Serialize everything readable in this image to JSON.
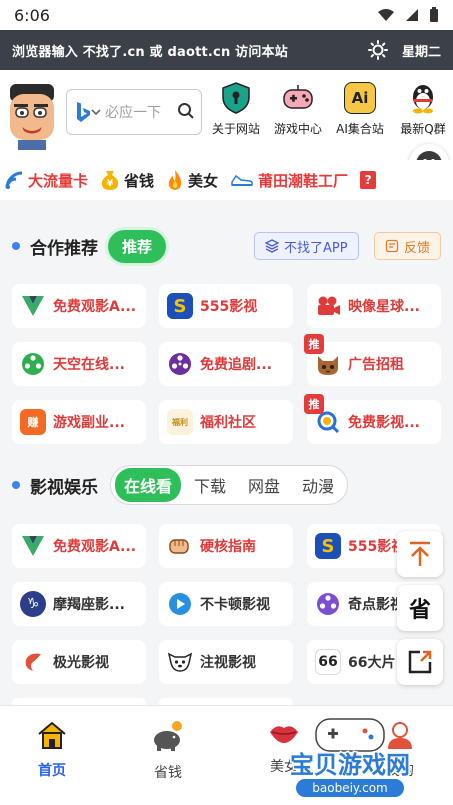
{
  "status": {
    "time": "6:06"
  },
  "banner": {
    "message": "浏览器输入 不找了.cn 或 daott.cn 访问本站",
    "weekday": "星期二"
  },
  "search": {
    "placeholder": "必应一下"
  },
  "quick_links": [
    {
      "label": "关于网站",
      "icon": "shield-keyhole-icon"
    },
    {
      "label": "游戏中心",
      "icon": "gamepad-icon"
    },
    {
      "label": "AI集合站",
      "icon": "ai-icon"
    },
    {
      "label": "最新Q群",
      "icon": "qq-penguin-icon"
    }
  ],
  "tags": [
    {
      "label": "大流量卡",
      "icon": "signal-icon"
    },
    {
      "label": "省钱",
      "icon": "money-bag-icon"
    },
    {
      "label": "美女",
      "icon": "fire-icon"
    },
    {
      "label": "莆田潮鞋工厂",
      "icon": "sneaker-icon"
    },
    {
      "label": "?",
      "icon": "question-icon"
    }
  ],
  "partner": {
    "title": "合作推荐",
    "pill": "推荐",
    "app_button": "不找了APP",
    "feedback_button": "反馈",
    "items": [
      {
        "label": "免费观影A...",
        "icon": "v-logo-icon",
        "style": "red"
      },
      {
        "label": "555影视",
        "icon": "s-logo-icon",
        "style": "red"
      },
      {
        "label": "映像星球...",
        "icon": "camera-icon",
        "style": "red"
      },
      {
        "label": "天空在线...",
        "icon": "film-reel-icon",
        "style": "red"
      },
      {
        "label": "免费追剧...",
        "icon": "film-reel-icon",
        "style": "red"
      },
      {
        "label": "广告招租",
        "icon": "cat-icon",
        "style": "red",
        "badge": "推"
      },
      {
        "label": "游戏副业...",
        "icon": "earn-icon",
        "style": "red"
      },
      {
        "label": "福利社区",
        "icon": "welfare-icon",
        "style": "red"
      },
      {
        "label": "免费影视...",
        "icon": "q-search-icon",
        "style": "red",
        "badge": "推"
      }
    ]
  },
  "video": {
    "title": "影视娱乐",
    "tabs": [
      "在线看",
      "下载",
      "网盘",
      "动漫"
    ],
    "items": [
      {
        "label": "免费观影A...",
        "icon": "v-logo-icon",
        "style": "red"
      },
      {
        "label": "硬核指南",
        "icon": "fist-icon",
        "style": "red"
      },
      {
        "label": "555影视",
        "icon": "s-logo-icon",
        "style": "red"
      },
      {
        "label": "摩羯座影...",
        "icon": "capricorn-icon",
        "style": "dark"
      },
      {
        "label": "不卡顿影视",
        "icon": "play-icon",
        "style": "dark"
      },
      {
        "label": "奇点影视",
        "icon": "film-reel-icon",
        "style": "dark"
      },
      {
        "label": "极光影视",
        "icon": "shrimp-icon",
        "style": "dark"
      },
      {
        "label": "注视影视",
        "icon": "dog-icon",
        "style": "dark"
      },
      {
        "label": "66大片",
        "icon": "66-logo-icon",
        "style": "dark"
      }
    ]
  },
  "side_buttons": [
    {
      "label": "↑",
      "icon": "arrow-up-icon"
    },
    {
      "label": "省"
    },
    {
      "label": "",
      "icon": "share-icon"
    }
  ],
  "bottom_nav": [
    {
      "label": "首页",
      "icon": "home-icon",
      "active": true
    },
    {
      "label": "省钱",
      "icon": "piggy-bank-icon",
      "active": false
    },
    {
      "label": "美女",
      "icon": "lips-icon",
      "active": false
    },
    {
      "label": "我的",
      "icon": "user-icon",
      "active": false
    }
  ],
  "watermark": {
    "title": "宝贝游戏网",
    "url": "baobeiy.com"
  },
  "colors": {
    "accent_green": "#2fbf5a",
    "accent_blue": "#2563eb",
    "banner_bg": "#3c4149",
    "red_text": "#e03a3a"
  }
}
